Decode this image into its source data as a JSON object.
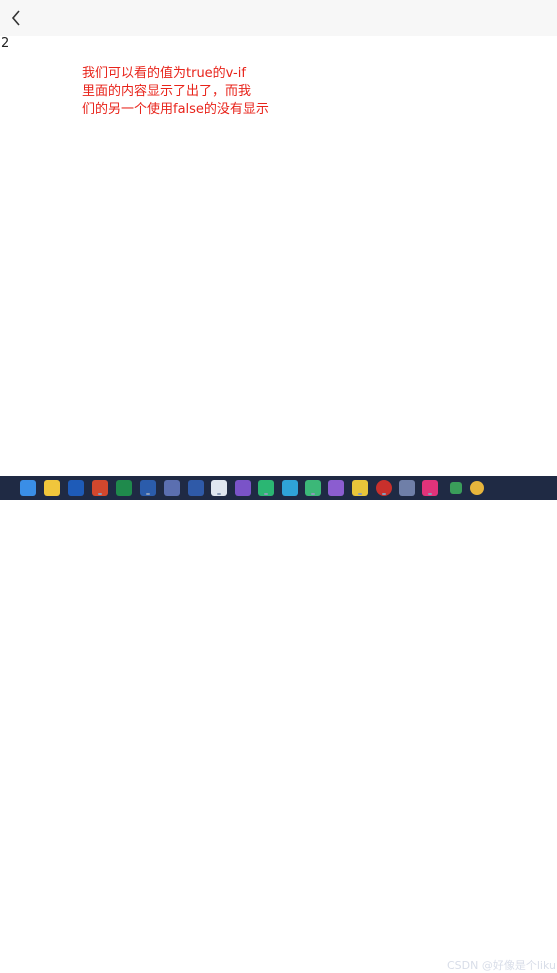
{
  "content": {
    "value_text": "2"
  },
  "annotation": {
    "lines": [
      "我们可以看的值为true的v-if",
      "里面的内容显示了出了，而我",
      "们的另一个使用false的没有显示"
    ],
    "color": "#e8231a"
  },
  "taskbar": {
    "watermark": "CSDN @好像是个likun",
    "icons": [
      "windows-start-icon",
      "file-explorer-icon",
      "pycharm-icon",
      "powerpoint-icon",
      "excel-icon",
      "word-icon",
      "network-icon",
      "word-app-icon",
      "visio-icon",
      "notes-icon",
      "visual-studio-icon",
      "media-player-icon",
      "edge-browser-icon",
      "chat-icon",
      "wechat-icon",
      "dev-tool-icon",
      "banana-icon",
      "typora-icon",
      "jetbrains-icon",
      "app-icon",
      "intellij-icon",
      "terminal-icon",
      "chrome-icon"
    ]
  },
  "colors": {
    "topbar_bg": "#f7f7f7",
    "taskbar_bg": "#1f2a44"
  }
}
